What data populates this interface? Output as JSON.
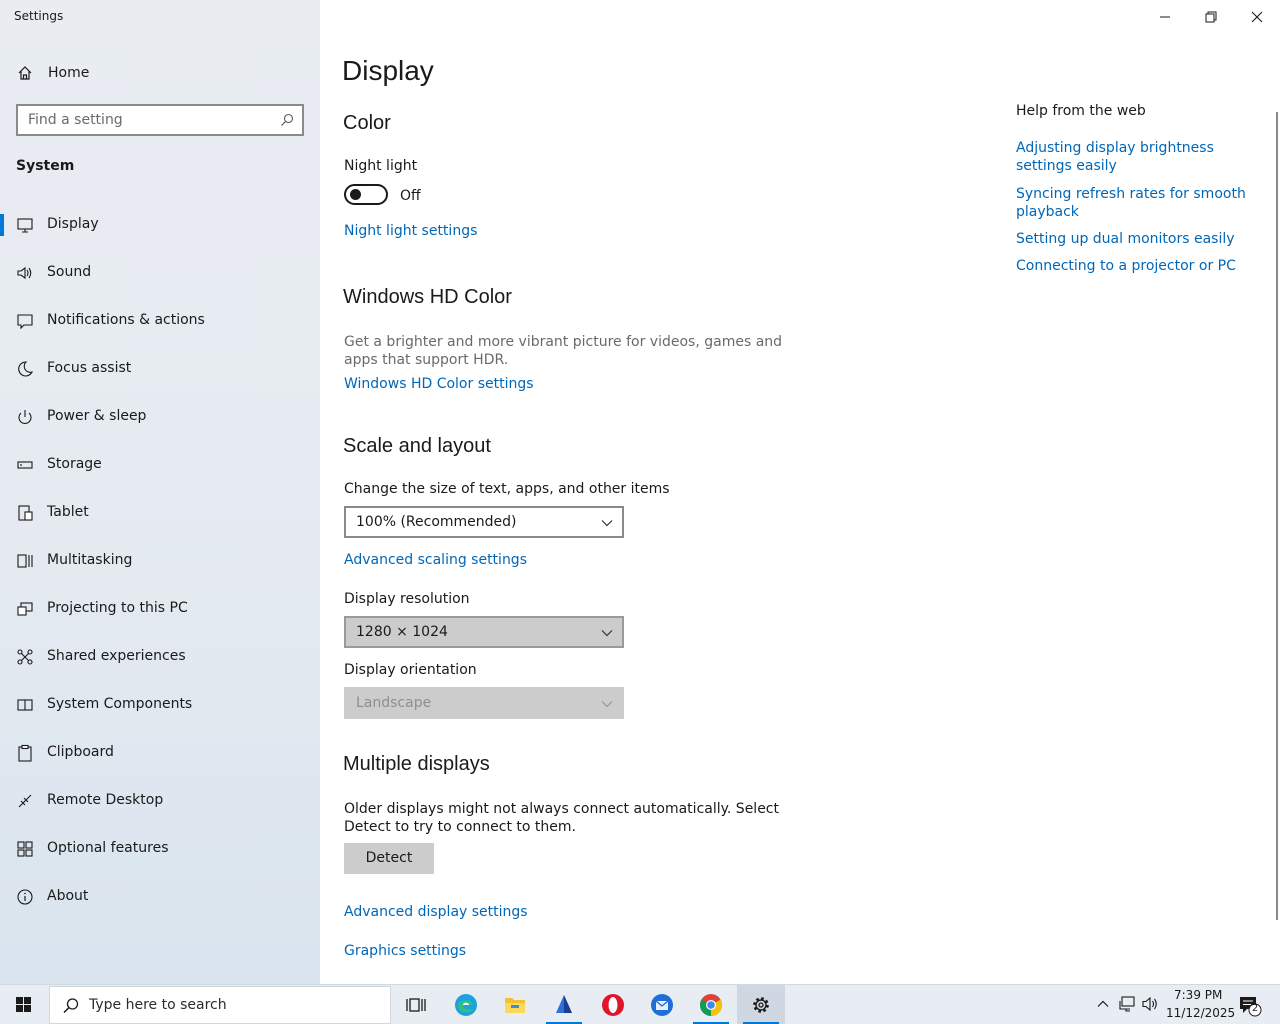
{
  "window": {
    "title": "Settings"
  },
  "sidebar": {
    "home_label": "Home",
    "search_placeholder": "Find a setting",
    "section_label": "System",
    "items": [
      {
        "label": "Display",
        "icon": "monitor-icon",
        "active": true
      },
      {
        "label": "Sound",
        "icon": "speaker-icon"
      },
      {
        "label": "Notifications & actions",
        "icon": "notification-icon"
      },
      {
        "label": "Focus assist",
        "icon": "moon-icon"
      },
      {
        "label": "Power & sleep",
        "icon": "power-icon"
      },
      {
        "label": "Storage",
        "icon": "storage-icon"
      },
      {
        "label": "Tablet",
        "icon": "tablet-icon"
      },
      {
        "label": "Multitasking",
        "icon": "multitasking-icon"
      },
      {
        "label": "Projecting to this PC",
        "icon": "projecting-icon"
      },
      {
        "label": "Shared experiences",
        "icon": "shared-icon"
      },
      {
        "label": "System Components",
        "icon": "components-icon"
      },
      {
        "label": "Clipboard",
        "icon": "clipboard-icon"
      },
      {
        "label": "Remote Desktop",
        "icon": "remote-desktop-icon"
      },
      {
        "label": "Optional features",
        "icon": "optional-features-icon"
      },
      {
        "label": "About",
        "icon": "info-icon"
      }
    ]
  },
  "main": {
    "page_title": "Display",
    "color": {
      "heading": "Color",
      "night_light_label": "Night light",
      "night_light_state": "Off",
      "night_light_settings_link": "Night light settings"
    },
    "hd_color": {
      "heading": "Windows HD Color",
      "description": "Get a brighter and more vibrant picture for videos, games and apps that support HDR.",
      "settings_link": "Windows HD Color settings"
    },
    "scale_layout": {
      "heading": "Scale and layout",
      "scale_label": "Change the size of text, apps, and other items",
      "scale_value": "100% (Recommended)",
      "advanced_scaling_link": "Advanced scaling settings",
      "resolution_label": "Display resolution",
      "resolution_value": "1280 × 1024",
      "orientation_label": "Display orientation",
      "orientation_value": "Landscape"
    },
    "multiple_displays": {
      "heading": "Multiple displays",
      "description": "Older displays might not always connect automatically. Select Detect to try to connect to them.",
      "detect_button": "Detect",
      "advanced_display_link": "Advanced display settings",
      "graphics_link": "Graphics settings"
    }
  },
  "help": {
    "title": "Help from the web",
    "links": [
      "Adjusting display brightness settings easily",
      "Syncing refresh rates for smooth playback",
      "Setting up dual monitors easily",
      "Connecting to a projector or PC"
    ]
  },
  "taskbar": {
    "search_placeholder": "Type here to search",
    "apps": [
      "task-view-icon",
      "edge-icon",
      "file-explorer-icon",
      "app-icon",
      "opera-icon",
      "thunderbird-icon",
      "chrome-icon",
      "settings-icon"
    ],
    "time": "7:39 PM",
    "date": "11/12/2025",
    "notification_count": "2"
  },
  "colors": {
    "accent": "#0078d7",
    "link": "#0067b8"
  }
}
